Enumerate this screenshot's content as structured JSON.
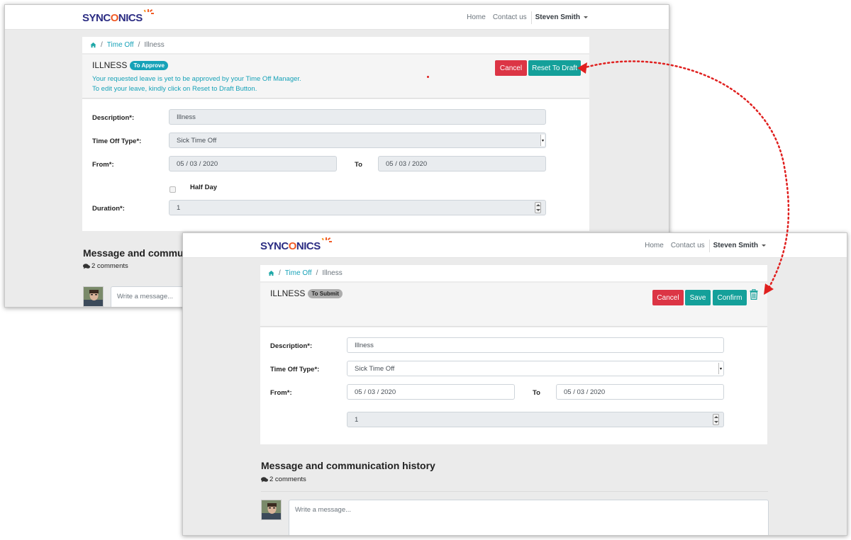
{
  "nav": {
    "brand_left": "SYNC",
    "brand_o": "O",
    "brand_right": "NICS",
    "home": "Home",
    "contact": "Contact us",
    "user": "Steven Smith"
  },
  "breadcrumb": {
    "item1": "Time Off",
    "sep": "/",
    "item2": "Illness"
  },
  "top": {
    "title": "ILLNESS",
    "badge": "To Approve",
    "info_line1": "Your requested leave is yet to be approved by your Time Off Manager.",
    "info_line2": "To edit your leave, kindly click on Reset to Draft Button.",
    "cancel": "Cancel",
    "reset": "Reset To Draft"
  },
  "bottom": {
    "title": "ILLNESS",
    "badge": "To Submit",
    "cancel": "Cancel",
    "save": "Save",
    "confirm": "Confirm"
  },
  "form": {
    "description_label": "Description*:",
    "description_value": "Illness",
    "type_label": "Time Off Type*:",
    "type_value": "Sick Time Off",
    "from_label": "From*:",
    "from_value": "05 / 03 / 2020",
    "to_label": "To",
    "to_value": "05 / 03 / 2020",
    "half_day_label": "Half Day",
    "duration_label": "Duration*:",
    "duration_value": "1"
  },
  "messages": {
    "title": "Message and communication history",
    "title_truncated": "Message and communi",
    "count": "2 comments",
    "placeholder": "Write a message..."
  },
  "colors": {
    "teal": "#14a09a",
    "danger": "#dc3545",
    "info": "#17a2b8",
    "arrow": "#e0201f"
  }
}
